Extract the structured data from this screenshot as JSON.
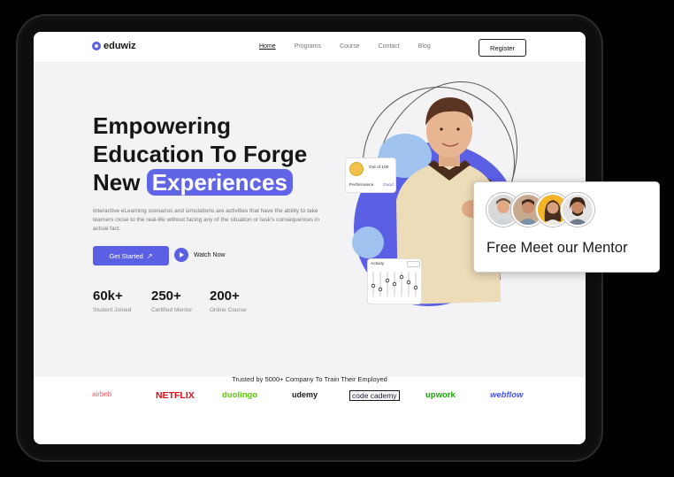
{
  "nav": {
    "logo": "eduwiz",
    "links": [
      "Home",
      "Programs",
      "Course",
      "Contact",
      "Blog"
    ],
    "register": "Register"
  },
  "hero": {
    "line1": "Empowering",
    "line2": "Education To Forge",
    "line3a": "New",
    "line3b": "Experiences",
    "description": "Interactive eLearning scenarios and simulations are activities that have the ability to take learners close to the real-life without facing any of the situation or task's consequences in actual fact.",
    "cta": "Get Started",
    "watch": "Watch Now"
  },
  "stats": [
    {
      "num": "60k+",
      "label": "Student Joined"
    },
    {
      "num": "250+",
      "label": "Certified Mentor"
    },
    {
      "num": "200+",
      "label": "Online Course"
    }
  ],
  "score_card": {
    "title": "Out of 100",
    "left": "Performance",
    "right": "Good"
  },
  "activity_card": {
    "title": "Activity"
  },
  "trusted": "Trusted by 5000+ Company To Train Their Employed",
  "brands": [
    "airbnb",
    "NETFLIX",
    "duolingo",
    "udemy",
    "code cademy",
    "upwork",
    "webflow"
  ],
  "mentor": {
    "text": "Free Meet our Mentor"
  },
  "colors": {
    "accent": "#5b5fe3",
    "light_blue": "#9fc3ee",
    "page_bg": "#000000"
  }
}
